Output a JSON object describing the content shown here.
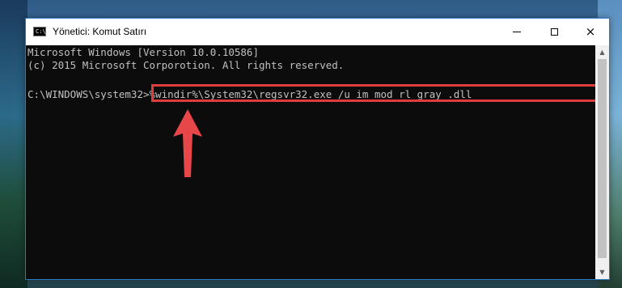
{
  "window": {
    "title": "Yönetici: Komut Satırı",
    "icon": "cmd-icon",
    "controls": {
      "minimize": "minimize-icon",
      "maximize": "maximize-icon",
      "close": "×"
    }
  },
  "console": {
    "lines": [
      "Microsoft Windows [Version 10.0.10586]",
      "(c) 2015 Microsoft Corporotion. All rights reserved."
    ],
    "prompt": "C:\\WINDOWS\\system32>",
    "command": "%windir%\\System32\\regsvr32.exe /u im_mod_rl_gray_.dll"
  },
  "annotation": {
    "highlight_color": "#e03c3c",
    "arrow": "up-arrow-icon"
  },
  "scrollbar": {
    "up": "▲",
    "down": "▼"
  },
  "colors": {
    "console_bg": "#0c0c0c",
    "console_text": "#c0c0c0",
    "accent": "#e03c3c"
  }
}
